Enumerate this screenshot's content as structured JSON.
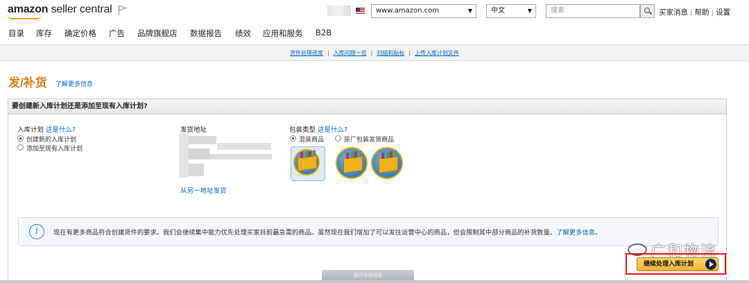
{
  "header": {
    "logo_brand": "amazon",
    "logo_suffix": "seller central",
    "marketplace_select": "www.amazon.com",
    "language_select": "中文",
    "search_placeholder": "搜索",
    "top_links": [
      "买家消息",
      "帮助",
      "设置"
    ]
  },
  "nav": {
    "items": [
      "目录",
      "库存",
      "确定价格",
      "广告",
      "品牌旗舰店",
      "数据报告",
      "绩效",
      "应用和服务",
      "B2B"
    ]
  },
  "subnav": {
    "links": [
      "货件处理进度",
      "入库问题一览",
      "扫描和贴标",
      "上传入库计划文件"
    ]
  },
  "page": {
    "title": "发/补货",
    "learn_more": "了解更多信息"
  },
  "panel": {
    "heading": "要创建新入库计划还是添加至现有入库计划?",
    "plan_label": "入库计划",
    "plan_help": "这是什么?",
    "plan_options": [
      "创建新的入库计划",
      "添加至现有入库计划"
    ],
    "address_label": "发货地址",
    "ship_from_other": "从另一地址发货",
    "packing_label": "包装类型",
    "packing_help": "这是什么?",
    "packing_options": [
      "混装商品",
      "原厂包装发货商品"
    ]
  },
  "info": {
    "text": "现在有更多商品符合创建货件的要求。我们会继续集中能力优先处理买家目前最急需的商品。虽然现在我们增加了可以发往运营中心的商品，但会限制其中部分商品的补货数量。",
    "link": "了解更多信息。"
  },
  "actions": {
    "continue": "继续处理入库计划"
  },
  "watermark": "广和物流",
  "bottom_tab": "展开仓储容量"
}
